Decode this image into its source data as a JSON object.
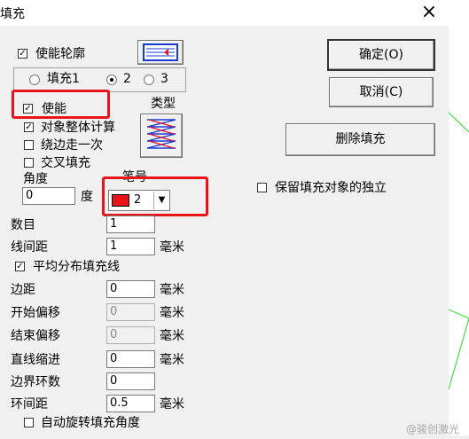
{
  "window": {
    "title": "填充",
    "close_icon": "×"
  },
  "outline": {
    "label": "使能轮廓",
    "checked": true
  },
  "fill_radio": {
    "options": [
      "填充1",
      "2",
      "3"
    ],
    "selected": "2"
  },
  "enable": {
    "label": "使能",
    "checked": true
  },
  "type_label": "类型",
  "whole_calc": {
    "label": "对象整体计算",
    "checked": true
  },
  "edge_once": {
    "label": "绕边走一次",
    "checked": false
  },
  "cross_fill": {
    "label": "交叉填充",
    "checked": false
  },
  "angle": {
    "label": "角度",
    "value": "0",
    "unit": "度"
  },
  "pen": {
    "label": "笔号",
    "value": "2",
    "color": "#e8141a"
  },
  "count": {
    "label": "数目",
    "value": "1"
  },
  "line_spacing": {
    "label": "线间距",
    "value": "1",
    "unit": "毫米"
  },
  "even_distribute": {
    "label": "平均分布填充线",
    "checked": true
  },
  "margin": {
    "label": "边距",
    "value": "0",
    "unit": "毫米"
  },
  "start_offset": {
    "label": "开始偏移",
    "value": "0",
    "unit": "毫米"
  },
  "end_offset": {
    "label": "结束偏移",
    "value": "0",
    "unit": "毫米"
  },
  "line_indent": {
    "label": "直线缩进",
    "value": "0",
    "unit": "毫米"
  },
  "border_loops": {
    "label": "边界环数",
    "value": "0"
  },
  "loop_spacing": {
    "label": "环间距",
    "value": "0.5",
    "unit": "毫米"
  },
  "auto_rotate": {
    "label": "自动旋转填充角度",
    "checked": false
  },
  "buttons": {
    "ok": "确定(O)",
    "cancel": "取消(C)",
    "delete": "删除填充"
  },
  "keep_independent": {
    "label": "保留填充对象的独立",
    "checked": false
  },
  "watermark": "@骏创激光",
  "colors": {
    "highlight": "#e8141a",
    "canvas_line": "#22dd22"
  }
}
